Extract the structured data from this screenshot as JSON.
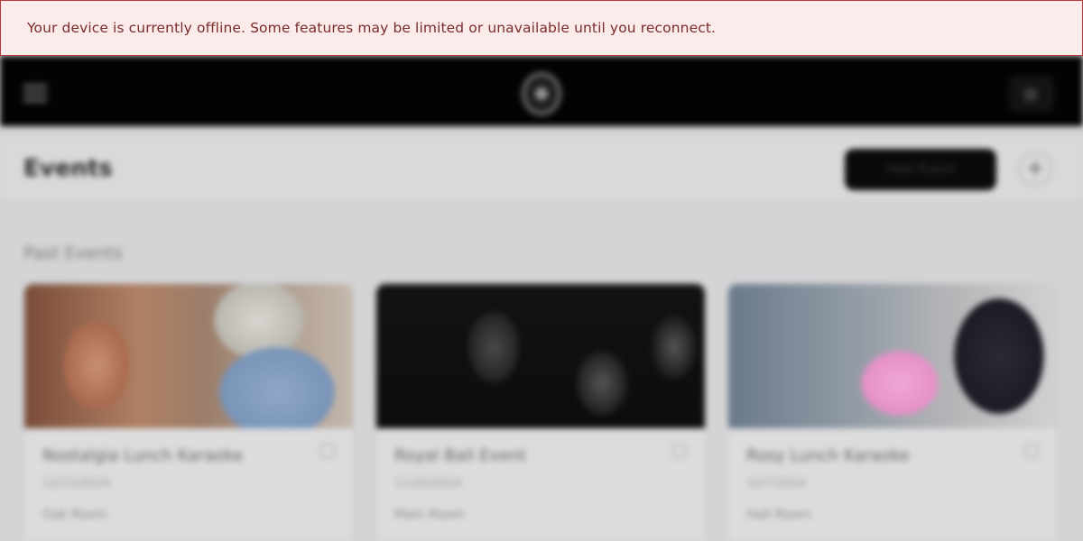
{
  "banner": {
    "message": "Your device is currently offline. Some features may be limited or unavailable until you reconnect."
  },
  "colors": {
    "banner_background": "#fbeceb",
    "banner_border": "#b3393a",
    "banner_text": "#7a2b2b",
    "topbar_background": "#030303"
  },
  "topbar": {
    "menu_icon": "hamburger-menu-icon",
    "logo_icon": "app-logo-icon"
  },
  "header": {
    "title": "Events",
    "create_label": "Host Event",
    "plus_label": "+"
  },
  "section": {
    "title": "Past Events"
  },
  "cards": [
    {
      "title": "Nostalgia Lunch Karaoke",
      "date": "12/12/2024",
      "location": "Oak Room",
      "menu_icon": "more-icon"
    },
    {
      "title": "Royal Ball Event",
      "date": "11/20/2024",
      "location": "Main Room",
      "menu_icon": "more-icon"
    },
    {
      "title": "Rosy Lunch Karaoke",
      "date": "10/7/2024",
      "location": "Hall Room",
      "menu_icon": "more-icon"
    }
  ]
}
